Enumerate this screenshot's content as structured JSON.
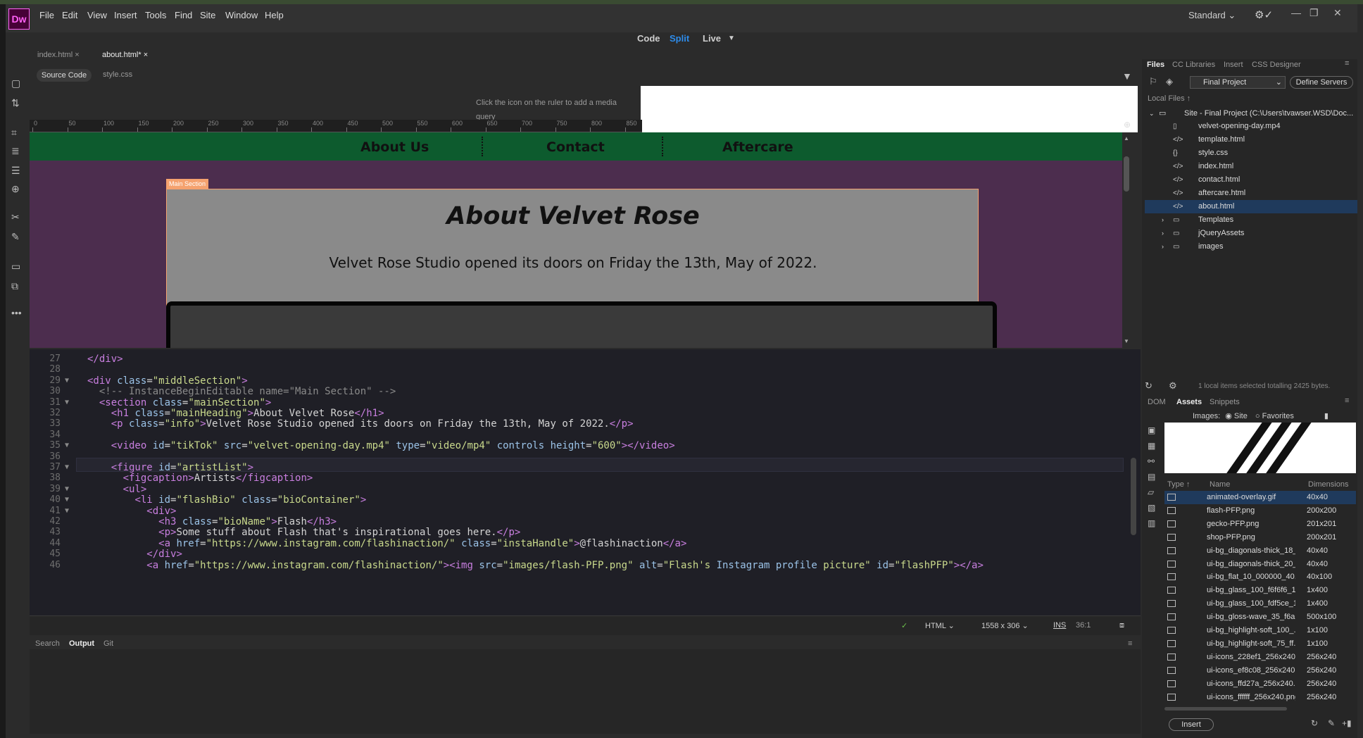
{
  "app": {
    "logo": "Dw",
    "workspace": "Standard"
  },
  "menu": [
    "File",
    "Edit",
    "View",
    "Insert",
    "Tools",
    "Find",
    "Site",
    "Window",
    "Help"
  ],
  "views": {
    "code": "Code",
    "split": "Split",
    "live": "Live"
  },
  "doc_tabs": [
    "index.html",
    "about.html*"
  ],
  "source_tabs": {
    "source": "Source Code",
    "css": "style.css"
  },
  "mq_hint": "Click the  icon on the ruler to add a media query",
  "ruler_labels": [
    "0",
    "50",
    "100",
    "150",
    "200",
    "250",
    "300",
    "350",
    "400",
    "450",
    "500",
    "550",
    "600",
    "650",
    "700",
    "750",
    "800",
    "850"
  ],
  "live": {
    "nav": [
      "About Us",
      "Contact",
      "Aftercare"
    ],
    "section_tag": "Main Section",
    "heading": "About Velvet Rose",
    "info": "Velvet Rose Studio opened its doors on Friday the 13th, May of 2022."
  },
  "code_lines": [
    {
      "n": "27",
      "t": "</div>"
    },
    {
      "n": "28",
      "t": ""
    },
    {
      "n": "29",
      "t": "<div class=\"middleSection\">"
    },
    {
      "n": "30",
      "t": "  <!-- InstanceBeginEditable name=\"Main Section\" -->"
    },
    {
      "n": "31",
      "t": "  <section class=\"mainSection\">"
    },
    {
      "n": "32",
      "t": "    <h1 class=\"mainHeading\">About Velvet Rose</h1>"
    },
    {
      "n": "33",
      "t": "    <p class=\"info\">Velvet Rose Studio opened its doors on Friday the 13th, May of 2022.</p>"
    },
    {
      "n": "34",
      "t": ""
    },
    {
      "n": "35",
      "t": "    <video id=\"tikTok\" src=\"velvet-opening-day.mp4\" type=\"video/mp4\" controls height=\"600\"></video>"
    },
    {
      "n": "36",
      "t": ""
    },
    {
      "n": "37",
      "t": "    <figure id=\"artistList\">"
    },
    {
      "n": "38",
      "t": "      <figcaption>Artists</figcaption>"
    },
    {
      "n": "39",
      "t": "      <ul>"
    },
    {
      "n": "40",
      "t": "        <li id=\"flashBio\" class=\"bioContainer\">"
    },
    {
      "n": "41",
      "t": "          <div>"
    },
    {
      "n": "42",
      "t": "            <h3 class=\"bioName\">Flash</h3>"
    },
    {
      "n": "43",
      "t": "            <p>Some stuff about Flash that's inspirational goes here.</p>"
    },
    {
      "n": "44",
      "t": "            <a href=\"https://www.instagram.com/flashinaction/\" class=\"instaHandle\">@flashinaction</a>"
    },
    {
      "n": "45",
      "t": "          </div>"
    },
    {
      "n": "46",
      "t": "          <a href=\"https://www.instagram.com/flashinaction/\"><img src=\"images/flash-PFP.png\" alt=\"Flash's Instagram profile picture\" id=\"flashPFP\"></a>"
    }
  ],
  "status": {
    "lang": "HTML",
    "size": "1558 x 306",
    "mode": "INS",
    "pos": "36:1"
  },
  "output_tabs": [
    "Search",
    "Output",
    "Git"
  ],
  "right_tabs": [
    "Files",
    "CC Libraries",
    "Insert",
    "CSS Designer"
  ],
  "files": {
    "project": "Final Project",
    "define_servers": "Define Servers",
    "local_files": "Local Files",
    "site_root": "Site - Final Project (C:\\Users\\tvawser.WSD\\Doc...",
    "items": [
      {
        "name": "velvet-opening-day.mp4",
        "icon": "file-icon"
      },
      {
        "name": "template.html",
        "icon": "code-file-icon"
      },
      {
        "name": "style.css",
        "icon": "css-file-icon"
      },
      {
        "name": "index.html",
        "icon": "code-file-icon"
      },
      {
        "name": "contact.html",
        "icon": "code-file-icon"
      },
      {
        "name": "aftercare.html",
        "icon": "code-file-icon"
      },
      {
        "name": "about.html",
        "icon": "code-file-icon"
      },
      {
        "name": "Templates",
        "icon": "folder-icon"
      },
      {
        "name": "jQueryAssets",
        "icon": "folder-icon"
      },
      {
        "name": "images",
        "icon": "folder-icon"
      }
    ],
    "selection_info": "1 local items selected totalling 2425 bytes."
  },
  "lower_tabs": [
    "DOM",
    "Assets",
    "Snippets"
  ],
  "assets": {
    "images_label": "Images:",
    "site": "Site",
    "favorites": "Favorites",
    "headers": {
      "type": "Type",
      "name": "Name",
      "dims": "Dimensions"
    },
    "rows": [
      {
        "name": "animated-overlay.gif",
        "dims": "40x40"
      },
      {
        "name": "flash-PFP.png",
        "dims": "200x200"
      },
      {
        "name": "gecko-PFP.png",
        "dims": "201x201"
      },
      {
        "name": "shop-PFP.png",
        "dims": "200x201"
      },
      {
        "name": "ui-bg_diagonals-thick_18_...",
        "dims": "40x40"
      },
      {
        "name": "ui-bg_diagonals-thick_20_...",
        "dims": "40x40"
      },
      {
        "name": "ui-bg_flat_10_000000_40...",
        "dims": "40x100"
      },
      {
        "name": "ui-bg_glass_100_f6f6f6_1...",
        "dims": "1x400"
      },
      {
        "name": "ui-bg_glass_100_fdf5ce_1...",
        "dims": "1x400"
      },
      {
        "name": "ui-bg_gloss-wave_35_f6a...",
        "dims": "500x100"
      },
      {
        "name": "ui-bg_highlight-soft_100_...",
        "dims": "1x100"
      },
      {
        "name": "ui-bg_highlight-soft_75_ff...",
        "dims": "1x100"
      },
      {
        "name": "ui-icons_228ef1_256x240....",
        "dims": "256x240"
      },
      {
        "name": "ui-icons_ef8c08_256x240....",
        "dims": "256x240"
      },
      {
        "name": "ui-icons_ffd27a_256x240....",
        "dims": "256x240"
      },
      {
        "name": "ui-icons_ffffff_256x240.png",
        "dims": "256x240"
      }
    ],
    "insert": "Insert"
  },
  "colors": {
    "nav_green": "#0d5b2e",
    "page_purple": "#4c2d4e",
    "accent": "#2d8ceb",
    "selection": "#1f3a5c"
  }
}
